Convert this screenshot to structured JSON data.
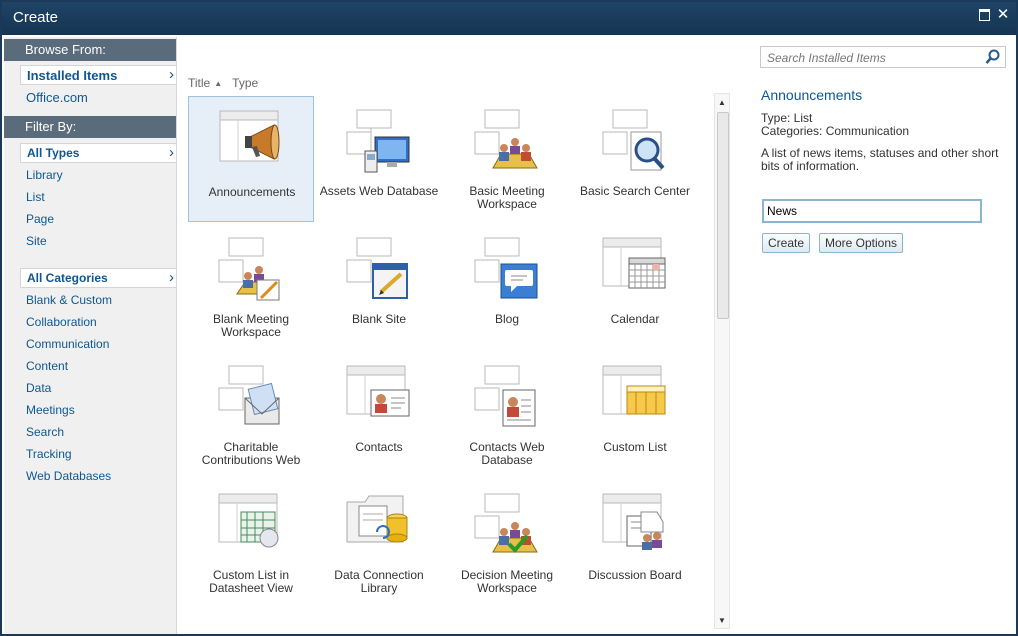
{
  "window": {
    "title": "Create",
    "maximize_icon": "maximize-icon",
    "close_label": "✕"
  },
  "sidebar": {
    "browse_heading": "Browse From:",
    "browse_items": [
      "Installed Items",
      "Office.com"
    ],
    "filter_heading": "Filter By:",
    "types_selected": "All Types",
    "types": [
      "Library",
      "List",
      "Page",
      "Site"
    ],
    "categories_selected": "All Categories",
    "categories": [
      "Blank & Custom",
      "Collaboration",
      "Communication",
      "Content",
      "Data",
      "Meetings",
      "Search",
      "Tracking",
      "Web Databases"
    ],
    "chevron": "›"
  },
  "sort": {
    "title_label": "Title",
    "type_label": "Type",
    "arrow": "▲"
  },
  "tiles": [
    {
      "label": "Announcements",
      "icon": "megaphone-icon"
    },
    {
      "label": "Assets Web Database",
      "icon": "computer-icon"
    },
    {
      "label": "Basic Meeting Workspace",
      "icon": "meeting-icon"
    },
    {
      "label": "Basic Search Center",
      "icon": "search-magnifier-icon"
    },
    {
      "label": "Blank Meeting Workspace",
      "icon": "meeting-pencil-icon"
    },
    {
      "label": "Blank Site",
      "icon": "blank-site-icon"
    },
    {
      "label": "Blog",
      "icon": "speech-bubble-icon"
    },
    {
      "label": "Calendar",
      "icon": "calendar-icon"
    },
    {
      "label": "Charitable Contributions Web",
      "icon": "envelope-icon"
    },
    {
      "label": "Contacts",
      "icon": "contact-card-icon"
    },
    {
      "label": "Contacts Web Database",
      "icon": "contact-list-icon"
    },
    {
      "label": "Custom List",
      "icon": "custom-list-icon"
    },
    {
      "label": "Custom List in Datasheet View",
      "icon": "datasheet-icon"
    },
    {
      "label": "Data Connection Library",
      "icon": "data-connection-icon"
    },
    {
      "label": "Decision Meeting Workspace",
      "icon": "decision-meeting-icon"
    },
    {
      "label": "Discussion Board",
      "icon": "discussion-board-icon"
    }
  ],
  "search": {
    "placeholder": "Search Installed Items",
    "icon": "search-icon"
  },
  "details": {
    "title": "Announcements",
    "type_line": "Type: List",
    "categories_line": "Categories: Communication",
    "description": "A list of news items, statuses and other short bits of information."
  },
  "name_field": {
    "value": "News"
  },
  "buttons": {
    "create": "Create",
    "more_options": "More Options"
  },
  "scroll": {
    "up": "▲",
    "down": "▼"
  },
  "colors": {
    "accent": "#0e5792",
    "titlebar": "#1f4466",
    "section": "#5a6b7b",
    "selection": "#e6eff7"
  }
}
